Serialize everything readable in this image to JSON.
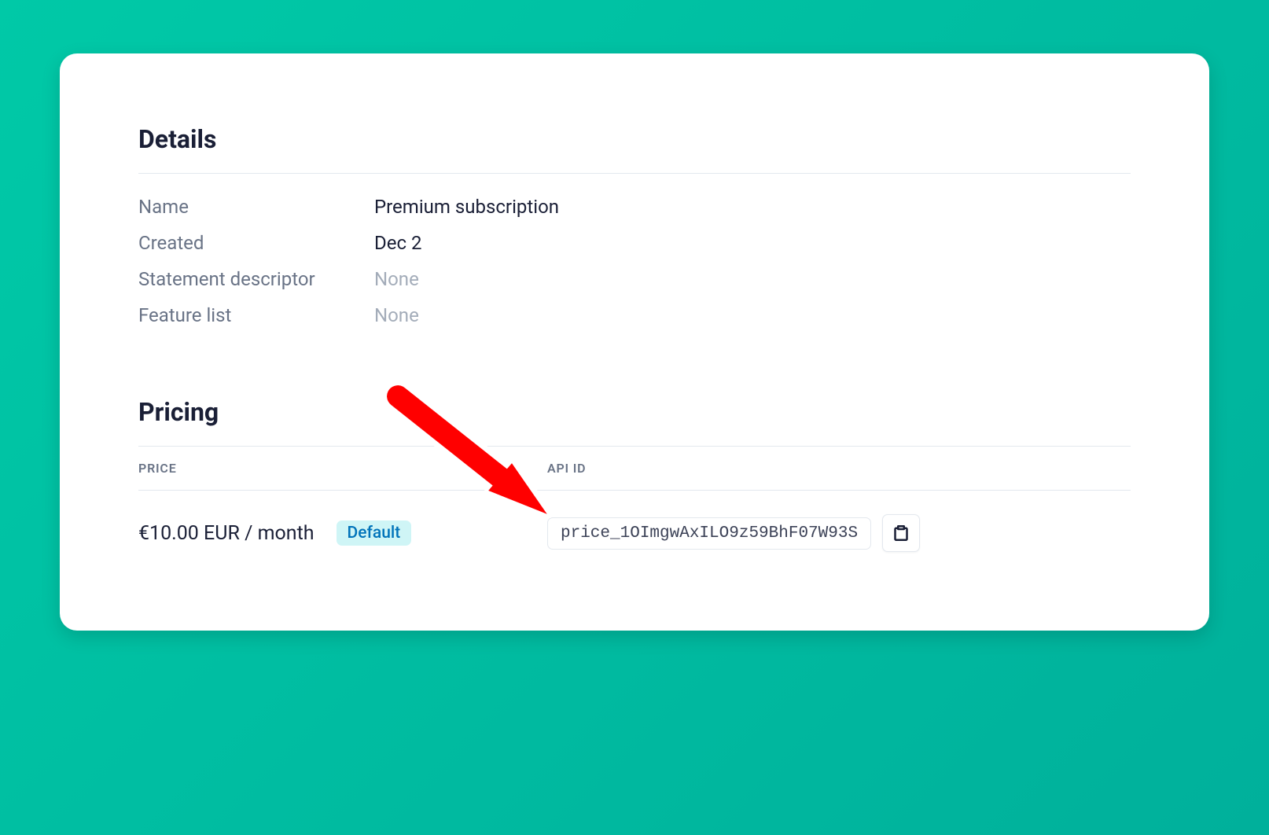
{
  "details": {
    "title": "Details",
    "rows": [
      {
        "label": "Name",
        "value": "Premium subscription",
        "muted": false
      },
      {
        "label": "Created",
        "value": "Dec 2",
        "muted": false
      },
      {
        "label": "Statement descriptor",
        "value": "None",
        "muted": true
      },
      {
        "label": "Feature list",
        "value": "None",
        "muted": true
      }
    ]
  },
  "pricing": {
    "title": "Pricing",
    "columns": {
      "price": "PRICE",
      "api_id": "API ID"
    },
    "rows": [
      {
        "price": "€10.00 EUR / month",
        "badge": "Default",
        "api_id": "price_1OImgwAxILO9z59BhF07W93S"
      }
    ]
  }
}
